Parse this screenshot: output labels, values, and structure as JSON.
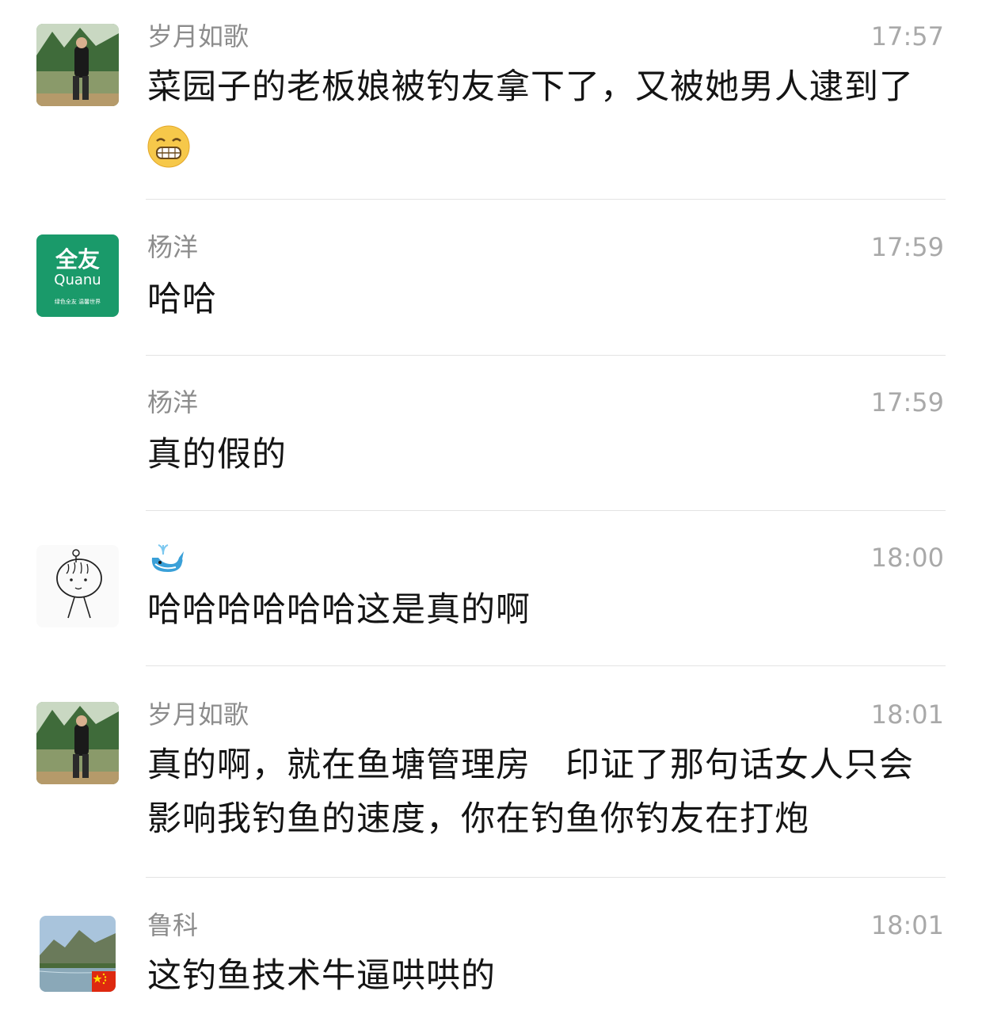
{
  "messages": [
    {
      "name": "岁月如歌",
      "time": "17:57",
      "text": "菜园子的老板娘被钓友拿下了，又被她男人逮到了",
      "emoji": "grinning-face-icon"
    },
    {
      "name": "杨洋",
      "time": "17:59",
      "text": "哈哈",
      "avatar_text": {
        "line1": "全友",
        "line2": "Quanu",
        "line3": "绿色全友 温馨世界"
      }
    },
    {
      "name": "杨洋",
      "time": "17:59",
      "text": "真的假的"
    },
    {
      "name_icon": "whale-icon",
      "time": "18:00",
      "text": "哈哈哈哈哈哈这是真的啊"
    },
    {
      "name": "岁月如歌",
      "time": "18:01",
      "text": "真的啊，就在鱼塘管理房　印证了那句话女人只会影响我钓鱼的速度，你在钓鱼你钓友在打炮"
    },
    {
      "name": "鲁科",
      "time": "18:01",
      "text": "这钓鱼技术牛逼哄哄的"
    }
  ],
  "colors": {
    "name": "#8c8c8c",
    "time": "#a9a9a9",
    "text": "#141414",
    "divider": "#e3e3e3",
    "quanu_green": "#1a9a6a"
  }
}
